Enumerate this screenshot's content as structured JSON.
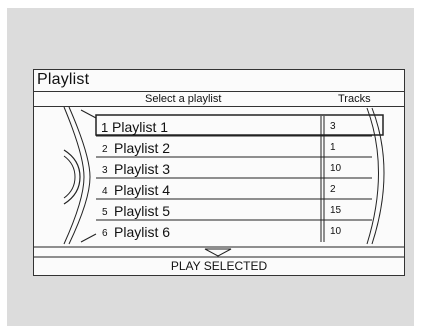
{
  "screen": {
    "title": "Playlist",
    "select_header": "Select a playlist",
    "tracks_header": "Tracks",
    "footer_action": "PLAY SELECTED",
    "scroll_indicator_icon": "triangle-down-icon"
  },
  "playlists": [
    {
      "number": "1",
      "name": "Playlist 1",
      "tracks": "3",
      "selected": true
    },
    {
      "number": "2",
      "name": "Playlist 2",
      "tracks": "1",
      "selected": false
    },
    {
      "number": "3",
      "name": "Playlist 3",
      "tracks": "10",
      "selected": false
    },
    {
      "number": "4",
      "name": "Playlist 4",
      "tracks": "2",
      "selected": false
    },
    {
      "number": "5",
      "name": "Playlist 5",
      "tracks": "15",
      "selected": false
    },
    {
      "number": "6",
      "name": "Playlist 6",
      "tracks": "10",
      "selected": false
    }
  ]
}
